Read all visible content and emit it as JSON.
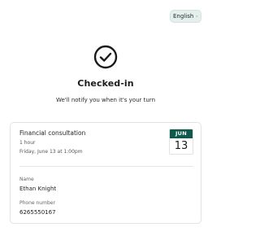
{
  "language": {
    "label": "English",
    "icon": "chevron-down-icon"
  },
  "status": {
    "icon": "check-circle-icon",
    "title": "Checked-in",
    "message": "We'll notify you when it's your turn"
  },
  "appointment": {
    "service": "Financial consultation",
    "duration": "1 hour",
    "datetime": "Friday, June 13 at 1:00pm",
    "badge": {
      "month": "JUN",
      "day": "13"
    }
  },
  "customer": {
    "name_label": "Name",
    "name": "Ethan Knight",
    "phone_label": "Phone number",
    "phone": "6265550167"
  },
  "colors": {
    "accent": "#0e5a4c",
    "lang_bg": "#e6efee"
  }
}
